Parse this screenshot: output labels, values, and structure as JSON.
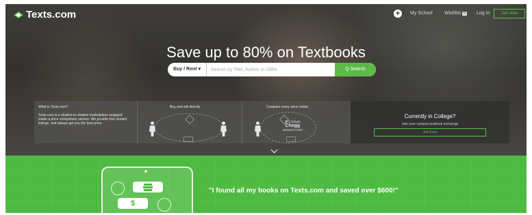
{
  "header": {
    "logo_text": "Texts.com",
    "nav": {
      "my_school": "My School",
      "wishlist": "Wishlist",
      "wishlist_count": "0",
      "login": "Log In",
      "join_now": "Join Now"
    }
  },
  "hero": {
    "headline": "Save up to 80% on Textbooks",
    "search": {
      "mode_label": "Buy / Rent ▾",
      "placeholder": "Search by Title, Author or ISBN",
      "button_label": "Q  Search"
    }
  },
  "info_panel": {
    "what_title": "What is Texts.com?",
    "what_body": "Texts.com is a student-to-student marketplace wrapped inside a price comparison service. We provide free student listings, and always get you the best price.",
    "buy_sell_title": "Buy and sell directly",
    "compare_title": "Compare every price online",
    "brands": [
      "@Cobbyte",
      "Chegg",
      "amazon.com"
    ],
    "college_title": "Currently in College?",
    "college_sub": "Join your campus textbook exchange",
    "join_free": "Join Free"
  },
  "testimonial": {
    "quote": "\"I found all my books on Texts.com and saved over $600!\""
  },
  "colors": {
    "accent_green": "#5cba47",
    "banner_green": "#4eba41"
  },
  "icons": [
    "logo-diamond-icon",
    "plus-icon",
    "chevron-down-icon",
    "user-icon",
    "dollar-icon",
    "book-icon"
  ]
}
